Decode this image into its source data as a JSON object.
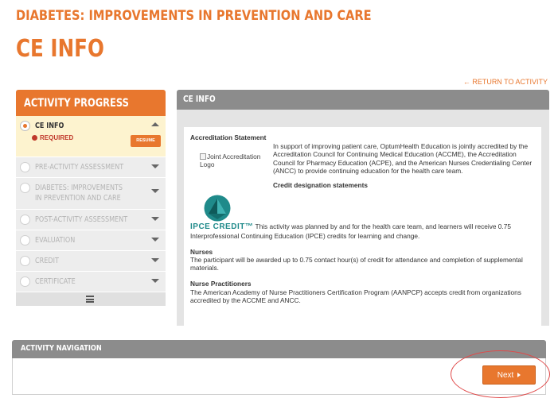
{
  "course_title": "DIABETES: IMPROVEMENTS IN PREVENTION AND CARE",
  "page_title": "CE INFO",
  "return_link": "← RETURN TO ACTIVITY",
  "sidebar": {
    "title": "ACTIVITY PROGRESS",
    "current_step": {
      "label": "CE INFO",
      "status": "REQUIRED",
      "resume_label": "RESUME"
    },
    "steps": [
      {
        "label": "PRE-ACTIVITY ASSESSMENT"
      },
      {
        "label": "DIABETES: IMPROVEMENTS IN PREVENTION AND CARE"
      },
      {
        "label": "POST-ACTIVITY ASSESSMENT"
      },
      {
        "label": "EVALUATION"
      },
      {
        "label": "CREDIT"
      },
      {
        "label": "CERTIFICATE"
      }
    ],
    "menu_icon": "hamburger-icon"
  },
  "content": {
    "header": "CE INFO",
    "accreditation_heading": "Accreditation Statement",
    "logo_alt": "Joint Accreditation Logo",
    "accreditation_text": "In support of improving patient care, OptumHealth Education is jointly accredited by the Accreditation Council for Continuing Medical Education (ACCME), the Accreditation Council for Pharmacy Education (ACPE), and the American Nurses Credentialing Center (ANCC) to provide continuing education for the health care team.",
    "credit_heading": "Credit designation statements",
    "ipce_label": "IPCE CREDIT™",
    "ipce_text": "This activity was planned by and for the health care team, and learners will receive 0.75 Interprofessional Continuing Education (IPCE) credits for learning and change.",
    "nurses_heading": "Nurses",
    "nurses_text": "The participant will be awarded up to 0.75 contact hour(s) of credit for attendance and completion of supplemental materials.",
    "np_heading": "Nurse Practitioners",
    "np_text": "The American Academy of Nurse Practitioners Certification Program (AANPCP) accepts credit from organizations accredited by the ACCME and ANCC."
  },
  "navigation": {
    "header": "ACTIVITY NAVIGATION",
    "next_label": "Next"
  },
  "colors": {
    "accent": "#e8772e",
    "header_gray": "#8c8c8c",
    "current_step_bg": "#fdf3cf",
    "ipce_teal": "#1f8a8a",
    "highlight": "#e04a4a"
  }
}
